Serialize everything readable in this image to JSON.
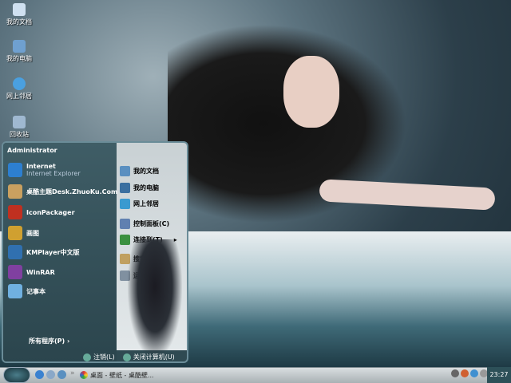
{
  "desktop": {
    "icons": [
      {
        "label": "我的文档"
      },
      {
        "label": "我的电脑"
      },
      {
        "label": "网上邻居"
      },
      {
        "label": "回收站"
      }
    ]
  },
  "start_menu": {
    "user": "Administrator",
    "left_items": [
      {
        "label": "Internet",
        "sub": "Internet Explorer",
        "icon": "ie-icon",
        "color": "#2d7fd0"
      },
      {
        "label": "桌酷主题Desk.ZhuoKu.Com",
        "icon": "zhuoku-icon",
        "color": "#c9a060"
      },
      {
        "label": "IconPackager",
        "icon": "iconpackager-icon",
        "color": "#c03020"
      },
      {
        "label": "画图",
        "icon": "paint-icon",
        "color": "#d0a030"
      },
      {
        "label": "KMPlayer中文版",
        "icon": "kmplayer-icon",
        "color": "#3070b0"
      },
      {
        "label": "WinRAR",
        "icon": "winrar-icon",
        "color": "#8040a0"
      },
      {
        "label": "记事本",
        "icon": "notepad-icon",
        "color": "#70b0e0"
      }
    ],
    "right_items": [
      {
        "label": "我的文档",
        "icon": "my-documents-icon",
        "color": "#5a8fc0"
      },
      {
        "label": "我的电脑",
        "icon": "my-computer-icon",
        "color": "#3a6fa0"
      },
      {
        "label": "网上邻居",
        "icon": "network-icon",
        "color": "#3a9ad0"
      },
      {
        "label": "控制面板(C)",
        "icon": "control-panel-icon",
        "color": "#6080b0"
      },
      {
        "label": "连接到(T)",
        "icon": "connect-icon",
        "color": "#3a9040"
      },
      {
        "label": "搜索(S)",
        "icon": "search-icon",
        "color": "#c0a060"
      },
      {
        "label": "运行(R)",
        "icon": "run-icon",
        "color": "#8090a0"
      }
    ],
    "all_programs": "所有程序(P)",
    "logoff": "注销(L)",
    "shutdown": "关闭计算机(U)"
  },
  "taskbar": {
    "task": "桌面 - 壁纸 - 桌酷壁...",
    "clock": "23:27"
  }
}
